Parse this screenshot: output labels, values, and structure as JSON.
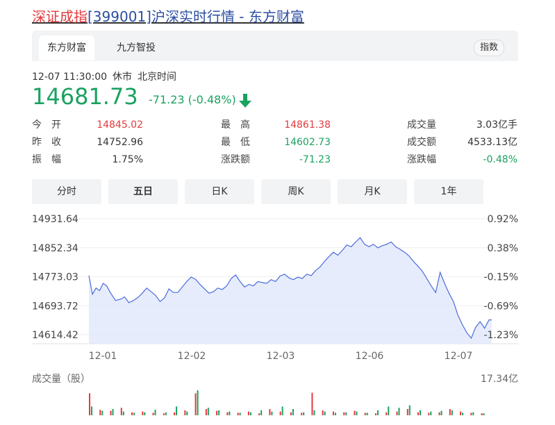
{
  "page_title": {
    "part1": "深证成指",
    "part2": "[399001]沪深实时行情 - 东方财富"
  },
  "tabs": [
    "东方财富",
    "九方智投"
  ],
  "index_badge": "指数",
  "status": {
    "datetime": "12-07 11:30:00",
    "market": "休市",
    "tz": "北京时间"
  },
  "quote": {
    "price": "14681.73",
    "change": "-71.23 (-0.48%)"
  },
  "stats": [
    [
      {
        "label": "今　开",
        "value": "14845.02",
        "color": "red"
      },
      {
        "label": "最　高",
        "value": "14861.38",
        "color": "red"
      },
      {
        "label": "成交量",
        "value": "3.03亿手",
        "color": "dark"
      }
    ],
    [
      {
        "label": "昨　收",
        "value": "14752.96",
        "color": "dark"
      },
      {
        "label": "最　低",
        "value": "14602.73",
        "color": "green"
      },
      {
        "label": "成交额",
        "value": "4533.13亿",
        "color": "dark"
      }
    ],
    [
      {
        "label": "振　幅",
        "value": "1.75%",
        "color": "dark"
      },
      {
        "label": "涨跌额",
        "value": "-71.23",
        "color": "green"
      },
      {
        "label": "涨跌幅",
        "value": "-0.48%",
        "color": "green"
      }
    ]
  ],
  "periods": [
    "分时",
    "五日",
    "日K",
    "周K",
    "月K",
    "1年"
  ],
  "active_period": "五日",
  "colors": {
    "up": "#e4393c",
    "down": "#1aa260",
    "line": "#4a6bdc",
    "fill": "#dfe5fb"
  },
  "chart_data": {
    "type": "line",
    "x_ticks": [
      "12-01",
      "12-02",
      "12-03",
      "12-06",
      "12-07"
    ],
    "y_ticks_left": [
      "14931.64",
      "14852.34",
      "14773.03",
      "14693.72",
      "14614.42"
    ],
    "y_ticks_right": [
      "0.92%",
      "0.38%",
      "-0.15%",
      "-0.69%",
      "-1.23%"
    ],
    "ylim": [
      14614.42,
      14931.64
    ],
    "x_unit": "trading-day index (0-5)",
    "series": [
      {
        "points": [
          [
            0.0,
            14776
          ],
          [
            0.04,
            14725
          ],
          [
            0.08,
            14742
          ],
          [
            0.12,
            14735
          ],
          [
            0.16,
            14755
          ],
          [
            0.2,
            14748
          ],
          [
            0.24,
            14730
          ],
          [
            0.3,
            14708
          ],
          [
            0.36,
            14712
          ],
          [
            0.4,
            14718
          ],
          [
            0.45,
            14702
          ],
          [
            0.5,
            14708
          ],
          [
            0.55,
            14716
          ],
          [
            0.6,
            14728
          ],
          [
            0.65,
            14742
          ],
          [
            0.7,
            14732
          ],
          [
            0.75,
            14722
          ],
          [
            0.8,
            14705
          ],
          [
            0.85,
            14715
          ],
          [
            0.9,
            14740
          ],
          [
            0.95,
            14730
          ],
          [
            1.0,
            14730
          ],
          [
            1.05,
            14745
          ],
          [
            1.1,
            14760
          ],
          [
            1.15,
            14772
          ],
          [
            1.2,
            14766
          ],
          [
            1.25,
            14752
          ],
          [
            1.3,
            14740
          ],
          [
            1.35,
            14728
          ],
          [
            1.4,
            14732
          ],
          [
            1.45,
            14742
          ],
          [
            1.5,
            14738
          ],
          [
            1.55,
            14748
          ],
          [
            1.6,
            14768
          ],
          [
            1.65,
            14778
          ],
          [
            1.7,
            14760
          ],
          [
            1.75,
            14745
          ],
          [
            1.8,
            14752
          ],
          [
            1.85,
            14748
          ],
          [
            1.9,
            14760
          ],
          [
            1.95,
            14757
          ],
          [
            2.0,
            14755
          ],
          [
            2.05,
            14765
          ],
          [
            2.1,
            14760
          ],
          [
            2.15,
            14775
          ],
          [
            2.2,
            14780
          ],
          [
            2.25,
            14770
          ],
          [
            2.3,
            14765
          ],
          [
            2.35,
            14772
          ],
          [
            2.4,
            14768
          ],
          [
            2.45,
            14780
          ],
          [
            2.5,
            14776
          ],
          [
            2.55,
            14790
          ],
          [
            2.6,
            14800
          ],
          [
            2.65,
            14815
          ],
          [
            2.7,
            14828
          ],
          [
            2.75,
            14840
          ],
          [
            2.8,
            14832
          ],
          [
            2.85,
            14845
          ],
          [
            2.9,
            14860
          ],
          [
            2.95,
            14855
          ],
          [
            3.0,
            14868
          ],
          [
            3.05,
            14880
          ],
          [
            3.1,
            14862
          ],
          [
            3.15,
            14855
          ],
          [
            3.2,
            14862
          ],
          [
            3.25,
            14852
          ],
          [
            3.3,
            14858
          ],
          [
            3.35,
            14862
          ],
          [
            3.4,
            14868
          ],
          [
            3.45,
            14855
          ],
          [
            3.5,
            14848
          ],
          [
            3.55,
            14840
          ],
          [
            3.6,
            14830
          ],
          [
            3.65,
            14815
          ],
          [
            3.7,
            14802
          ],
          [
            3.75,
            14788
          ],
          [
            3.8,
            14768
          ],
          [
            3.85,
            14748
          ],
          [
            3.9,
            14730
          ],
          [
            3.95,
            14785
          ],
          [
            4.0,
            14755
          ],
          [
            4.05,
            14728
          ],
          [
            4.1,
            14705
          ],
          [
            4.15,
            14668
          ],
          [
            4.2,
            14642
          ],
          [
            4.25,
            14620
          ],
          [
            4.3,
            14605
          ],
          [
            4.35,
            14635
          ],
          [
            4.4,
            14650
          ],
          [
            4.45,
            14632
          ],
          [
            4.5,
            14655
          ],
          [
            4.53,
            14655
          ]
        ]
      }
    ],
    "volume": {
      "title": "成交量（股）",
      "max_label": "17.34亿",
      "bars_up": [
        0.88,
        0.22,
        0.18,
        0.3,
        0.12,
        0.15,
        0.1,
        0.08,
        0.12,
        0.2,
        0.88,
        0.25,
        0.18,
        0.12,
        0.1,
        0.15,
        0.08,
        0.25,
        0.15,
        0.12,
        0.1,
        0.9,
        0.2,
        0.15,
        0.12,
        0.18,
        0.1,
        0.08,
        0.12,
        0.15,
        0.25,
        0.12,
        0.1,
        0.12,
        0.25,
        0.15,
        0.1,
        0.08
      ],
      "bars_down": [
        0.35,
        0.18,
        0.25,
        0.15,
        0.1,
        0.12,
        0.22,
        0.12,
        0.35,
        0.15,
        1.0,
        0.3,
        0.2,
        0.15,
        0.1,
        0.12,
        0.2,
        0.15,
        0.35,
        0.25,
        0.12,
        0.2,
        0.15,
        0.1,
        0.12,
        0.15,
        0.1,
        0.2,
        0.35,
        0.3,
        0.4,
        0.2,
        0.15,
        0.18,
        0.2,
        0.1,
        0.12,
        0.08
      ]
    }
  }
}
